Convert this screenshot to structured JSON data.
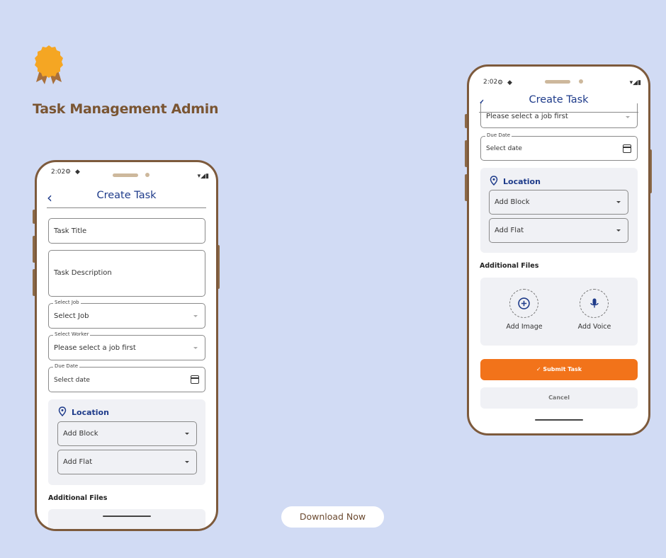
{
  "brand": {
    "headline": "Task Management Admin",
    "badge_color": "#f5a623",
    "ribbon_color": "#a8703c",
    "text_color": "#7a5532"
  },
  "download_button": {
    "label": "Download Now"
  },
  "phone_left": {
    "status_time": "2:02",
    "app_title": "Create Task",
    "task_title_placeholder": "Task Title",
    "task_description_placeholder": "Task Description",
    "select_job": {
      "label": "Select Job",
      "value": "Select Job"
    },
    "select_worker": {
      "label": "Select Worker",
      "value": "Please select a job first"
    },
    "due_date": {
      "label": "Due Date",
      "value": "Select date"
    },
    "location": {
      "title": "Location",
      "block": "Add Block",
      "flat": "Add Flat"
    },
    "additional_files_title": "Additional Files"
  },
  "phone_right": {
    "status_time": "2:02",
    "app_title": "Create Task",
    "select_worker_value": "Please select a job first",
    "due_date": {
      "label": "Due Date",
      "value": "Select date"
    },
    "location": {
      "title": "Location",
      "block": "Add Block",
      "flat": "Add Flat"
    },
    "additional_files_title": "Additional Files",
    "add_image": "Add Image",
    "add_voice": "Add Voice",
    "submit": "✓ Submit Task",
    "cancel": "Cancel"
  },
  "colors": {
    "background": "#d1dbf4",
    "accent": "#1e3b8a",
    "submit": "#f2731a",
    "phone_frame": "#7d5a3c"
  }
}
